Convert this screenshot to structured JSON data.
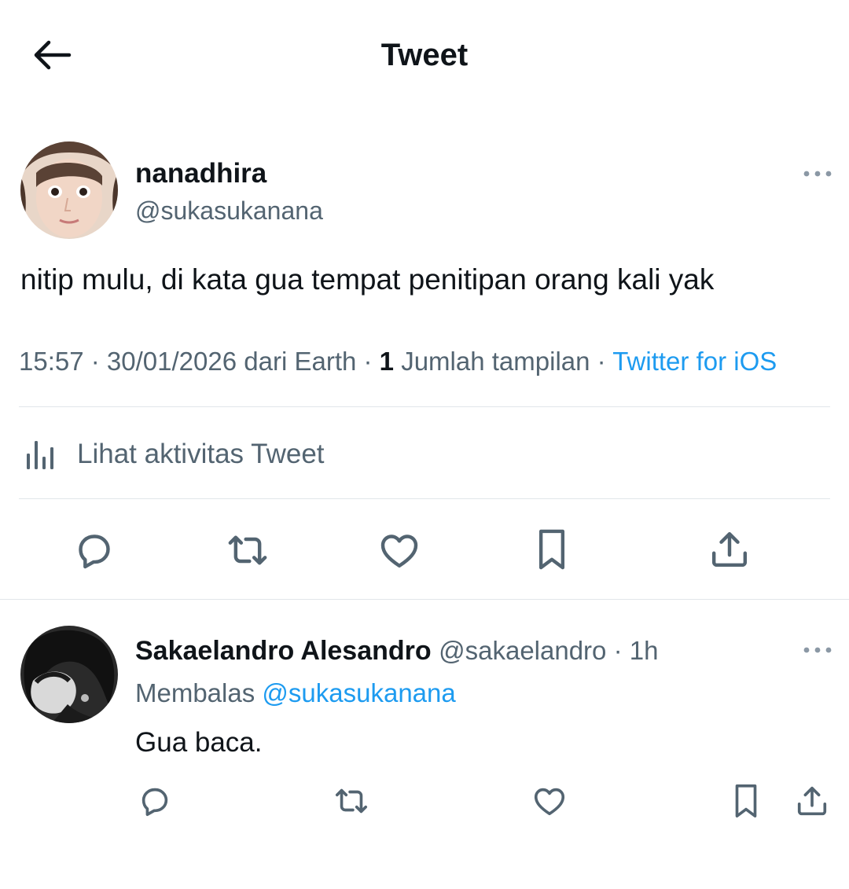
{
  "header": {
    "title": "Tweet"
  },
  "tweet": {
    "display_name": "nanadhira",
    "handle": "@sukasukanana",
    "text": "nitip mulu, di kata gua tempat penitipan orang kali yak",
    "meta": {
      "time": "15:57",
      "date": "30/01/2026",
      "location": "dari Earth",
      "views_count": "1",
      "views_label": "Jumlah tampilan",
      "source": "Twitter for iOS"
    },
    "activity_label": "Lihat aktivitas Tweet",
    "actions": [
      "reply",
      "retweet",
      "like",
      "bookmark",
      "share"
    ]
  },
  "reply": {
    "display_name": "Sakaelandro Alesandro",
    "handle": "@sakaelandro",
    "time": "1h",
    "replying_prefix": "Membalas",
    "replying_to": "@sukasukanana",
    "text": "Gua baca."
  },
  "colors": {
    "text": "#0f1419",
    "muted": "#536471",
    "link": "#1d9bf0",
    "divider": "#e1e6ea"
  }
}
